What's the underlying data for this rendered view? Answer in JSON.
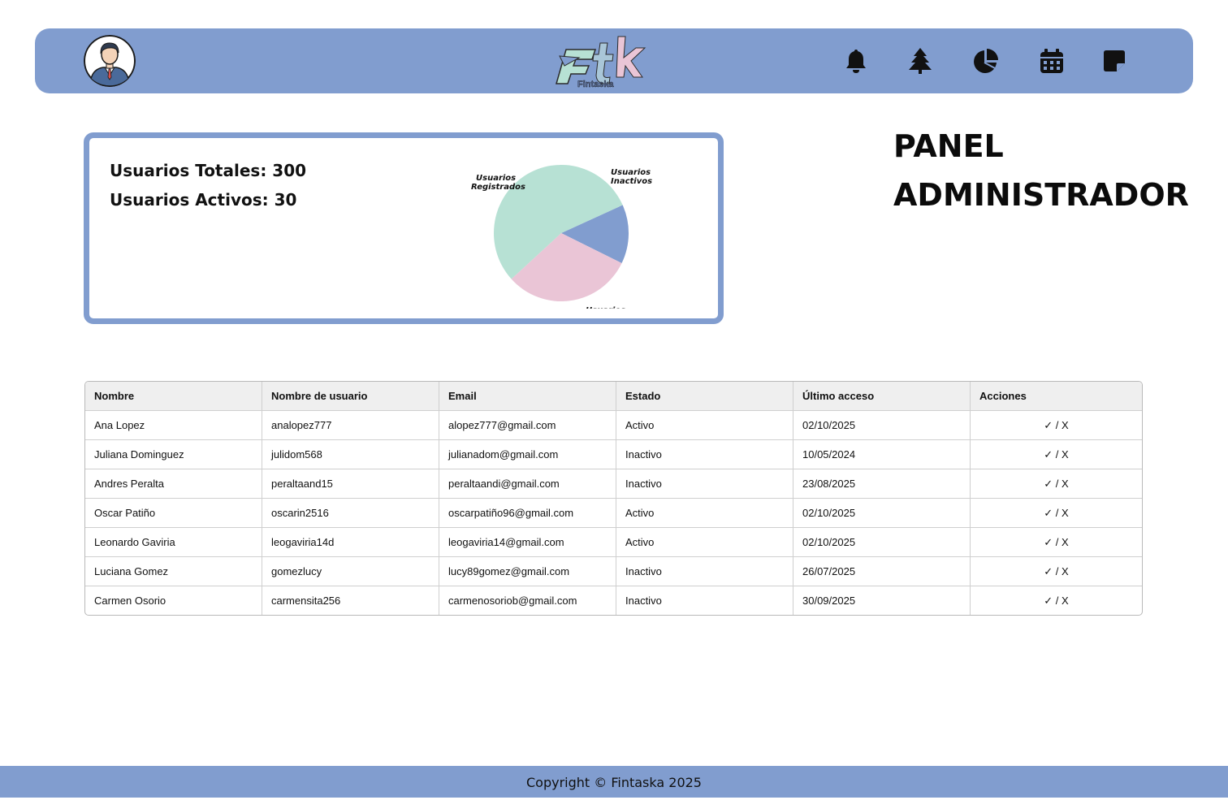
{
  "header": {
    "logo_text": "Ftk",
    "logo_subtext": "Fintaska",
    "colors": {
      "bar": "#819dcf"
    },
    "icons": [
      "avatar-icon",
      "bell-icon",
      "tree-icon",
      "pie-chart-icon",
      "calendar-icon",
      "note-icon"
    ]
  },
  "stats": {
    "total_users": "Usuarios Totales: 300",
    "active_users": "Usuarios Activos: 30"
  },
  "chart_data": {
    "type": "pie",
    "slices": [
      {
        "label": "Usuarios Registrados",
        "fraction": 0.55,
        "color": "#b7e1d4"
      },
      {
        "label": "Usuarios Inactivos",
        "fraction": 0.14,
        "color": "#819dcf"
      },
      {
        "label": "Usuarios",
        "fraction": 0.31,
        "color": "#eac5d6"
      }
    ]
  },
  "page_title": {
    "line1": "PANEL",
    "line2": "ADMINISTRADOR"
  },
  "table": {
    "columns": [
      "Nombre",
      "Nombre de usuario",
      "Email",
      "Estado",
      "Último acceso",
      "Acciones"
    ],
    "rows": [
      [
        "Ana Lopez",
        "analopez777",
        "alopez777@gmail.com",
        "Activo",
        "02/10/2025"
      ],
      [
        "Juliana Dominguez",
        "julidom568",
        "julianadom@gmail.com",
        "Inactivo",
        "10/05/2024"
      ],
      [
        "Andres Peralta",
        "peraltaand15",
        "peraltaandi@gmail.com",
        "Inactivo",
        "23/08/2025"
      ],
      [
        "Oscar Patiño",
        "oscarin2516",
        "oscarpatiño96@gmail.com",
        "Activo",
        "02/10/2025"
      ],
      [
        "Leonardo Gaviria",
        "leogaviria14d",
        "leogaviria14@gmail.com",
        "Activo",
        "02/10/2025"
      ],
      [
        "Luciana Gomez",
        "gomezlucy",
        "lucy89gomez@gmail.com",
        "Inactivo",
        "26/07/2025"
      ],
      [
        "Carmen Osorio",
        "carmensita256",
        "carmenosoriob@gmail.com",
        "Inactivo",
        "30/09/2025"
      ]
    ],
    "actions": {
      "approve": "✓",
      "separator": " / ",
      "reject": "X"
    }
  },
  "footer": {
    "copyright": "Copyright © Fintaska 2025"
  }
}
